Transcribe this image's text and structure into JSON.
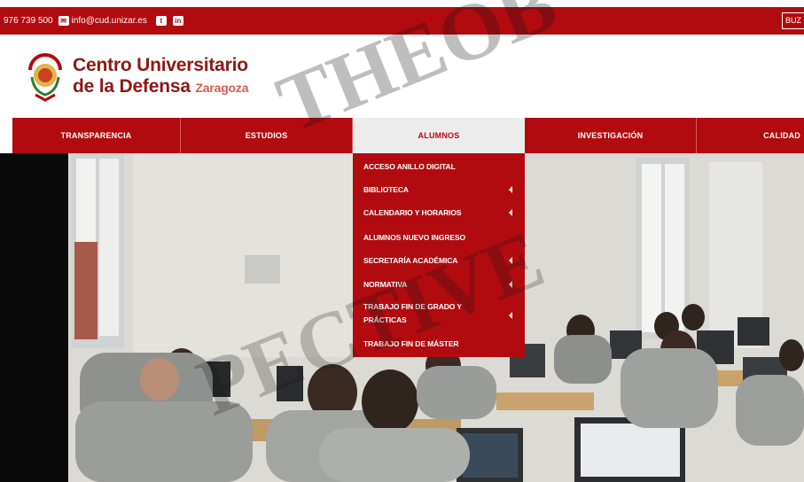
{
  "topbar": {
    "phone": "976 739 500",
    "email": "info@cud.unizar.es",
    "buzon": "BUZ"
  },
  "brand": {
    "line1": "Centro Universitario",
    "line2": "de la Defensa",
    "city": "Zaragoza"
  },
  "nav": [
    {
      "label": "TRANSPARENCIA"
    },
    {
      "label": "ESTUDIOS"
    },
    {
      "label": "ALUMNOS"
    },
    {
      "label": "INVESTIGACIÓN"
    },
    {
      "label": "CALIDAD"
    }
  ],
  "dropdown": [
    {
      "label": "ACCESO ANILLO DIGITAL"
    },
    {
      "label": "BIBLIOTECA"
    },
    {
      "label": "CALENDARIO Y HORARIOS"
    },
    {
      "label": "ALUMNOS NUEVO INGRESO"
    },
    {
      "label": "SECRETARÍA ACADÉMICA"
    },
    {
      "label": "NORMATIVA"
    },
    {
      "label": "TRABAJO FIN DE GRADO Y PRÁCTICAS"
    },
    {
      "label": "TRABAJO FIN DE MÁSTER"
    }
  ],
  "watermark": {
    "text1": "THEOB",
    "text2": "PECTIVE"
  },
  "colors": {
    "primary_red": "#b10b10",
    "brand_text": "#8b1a14",
    "city_text": "#d35c52",
    "active_nav_bg": "#ececec"
  }
}
